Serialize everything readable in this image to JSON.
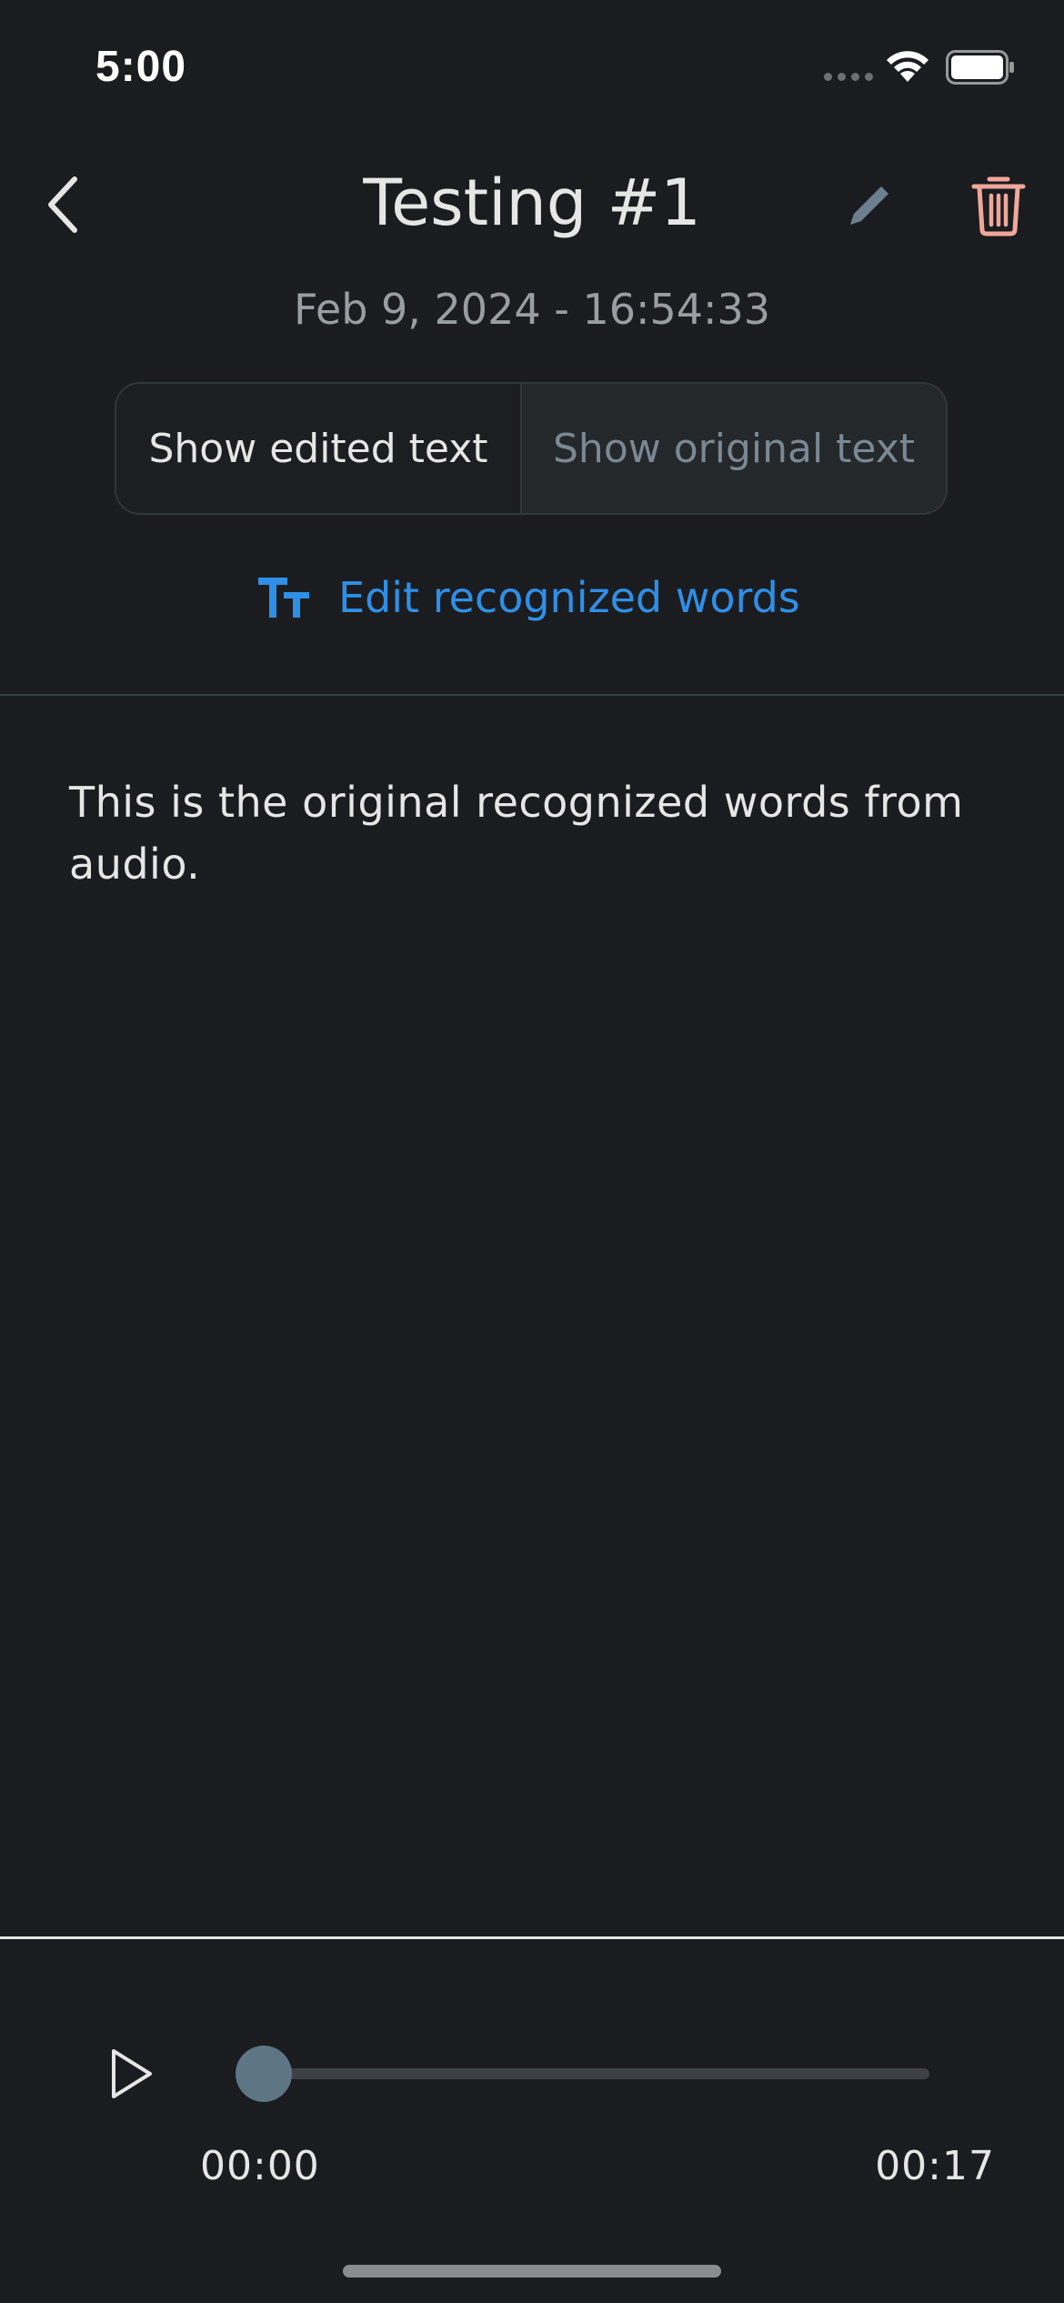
{
  "status_bar": {
    "time": "5:00"
  },
  "header": {
    "title": "Testing #1",
    "date": "Feb 9, 2024 - 16:54:33",
    "back_icon": "chevron-left-icon",
    "edit_icon": "pencil-icon",
    "delete_icon": "trash-icon"
  },
  "segmented_control": {
    "options": [
      {
        "label": "Show edited text",
        "selected": false
      },
      {
        "label": "Show original text",
        "selected": true
      }
    ]
  },
  "edit_words": {
    "label": "Edit recognized words",
    "icon": "text-size-icon"
  },
  "content": {
    "text": "This is the original recognized words from audio."
  },
  "player": {
    "current_time": "00:00",
    "total_time": "00:17",
    "progress": 0.0,
    "play_icon": "play-icon"
  },
  "colors": {
    "background": "#1a1c1f",
    "accent": "#2f8fe6",
    "delete": "#f0a79a",
    "edit_icon": "#6b7f8e",
    "thumb": "#5d7585"
  }
}
